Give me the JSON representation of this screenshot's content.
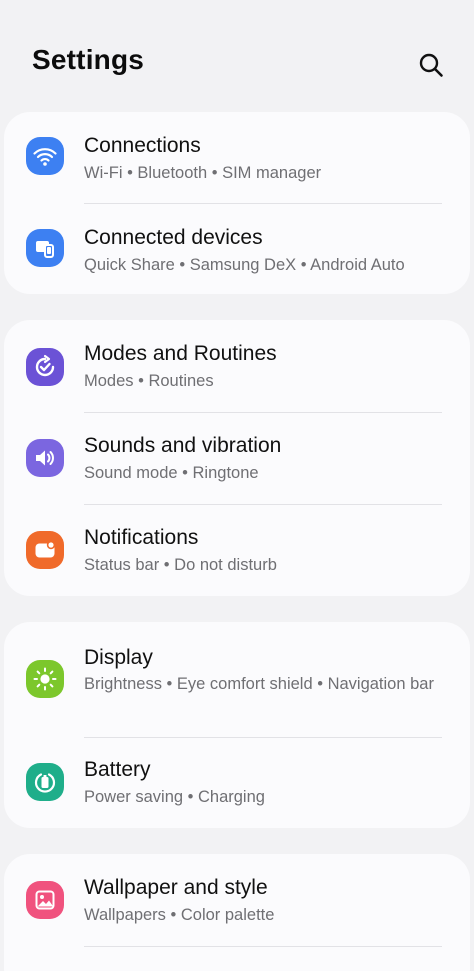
{
  "header": {
    "title": "Settings",
    "search_icon": "search-icon"
  },
  "groups": [
    {
      "items": [
        {
          "title": "Connections",
          "subtitle": "Wi-Fi  •  Bluetooth  •  SIM manager",
          "icon": "wifi-icon",
          "color": "#3d80f2"
        },
        {
          "title": "Connected devices",
          "subtitle": "Quick Share  •  Samsung DeX  •  Android Auto",
          "icon": "devices-icon",
          "color": "#3d80f2"
        }
      ]
    },
    {
      "items": [
        {
          "title": "Modes and Routines",
          "subtitle": "Modes  •  Routines",
          "icon": "routines-icon",
          "color": "#6b52d6"
        },
        {
          "title": "Sounds and vibration",
          "subtitle": "Sound mode  •  Ringtone",
          "icon": "speaker-icon",
          "color": "#7b66e0"
        },
        {
          "title": "Notifications",
          "subtitle": "Status bar  •  Do not disturb",
          "icon": "notification-icon",
          "color": "#f06a2a"
        }
      ]
    },
    {
      "items": [
        {
          "title": "Display",
          "subtitle": "Brightness  •  Eye comfort shield  •  Navigation bar",
          "icon": "brightness-icon",
          "color": "#7cc72c"
        },
        {
          "title": "Battery",
          "subtitle": "Power saving  •  Charging",
          "icon": "battery-icon",
          "color": "#1fae8a"
        }
      ]
    },
    {
      "items": [
        {
          "title": "Wallpaper and style",
          "subtitle": "Wallpapers  •  Color palette",
          "icon": "wallpaper-icon",
          "color": "#f0527e"
        }
      ]
    }
  ]
}
